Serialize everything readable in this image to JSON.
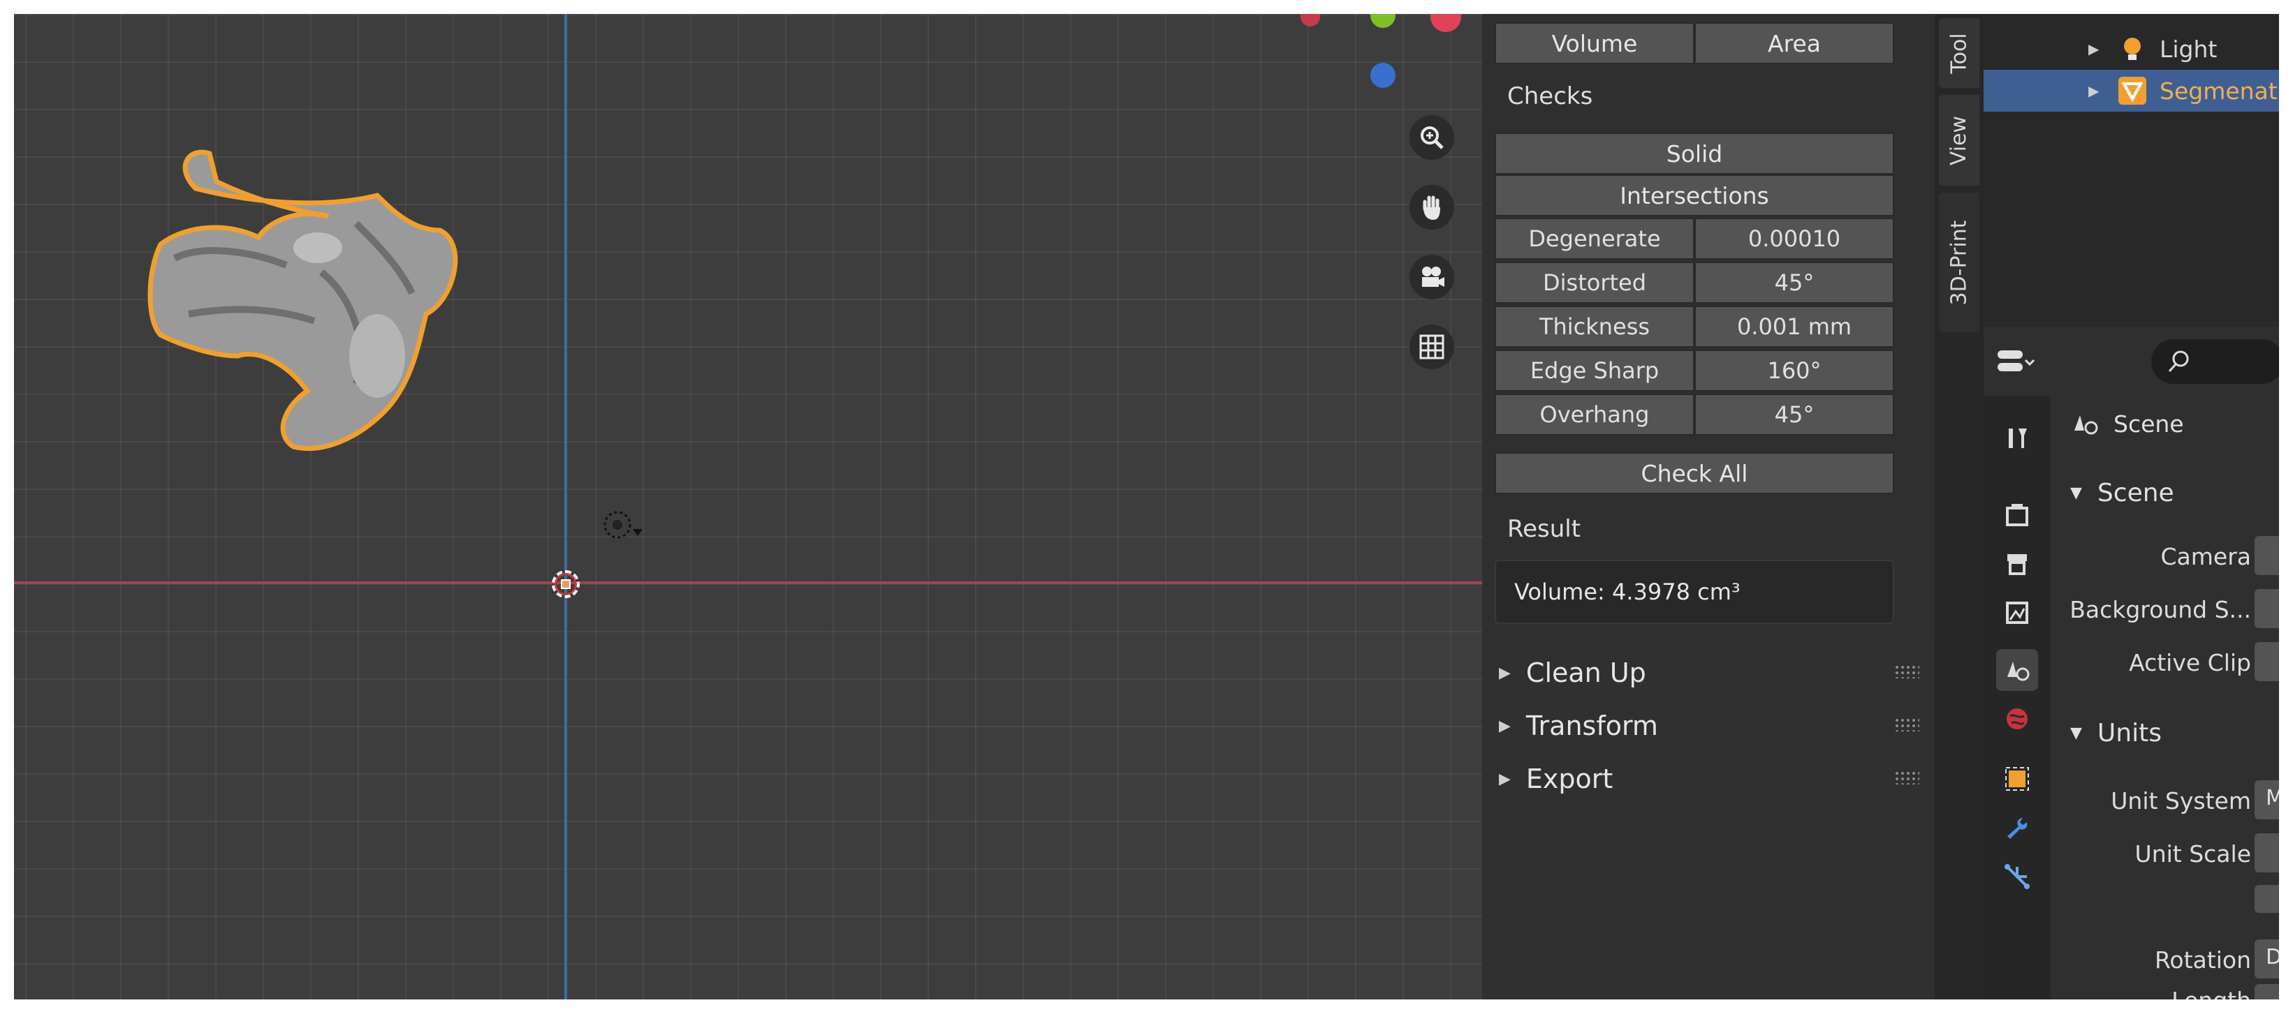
{
  "sidebar_panel": {
    "mode_buttons": [
      "Volume",
      "Area"
    ],
    "checks_label": "Checks",
    "check_buttons": [
      "Solid",
      "Intersections"
    ],
    "check_params": [
      {
        "label": "Degenerate",
        "value": "0.00010"
      },
      {
        "label": "Distorted",
        "value": "45°"
      },
      {
        "label": "Thickness",
        "value": "0.001 mm"
      },
      {
        "label": "Edge Sharp",
        "value": "160°"
      },
      {
        "label": "Overhang",
        "value": "45°"
      }
    ],
    "check_all_label": "Check All",
    "result_label": "Result",
    "result_value": "Volume: 4.3978 cm³",
    "sections": [
      "Clean Up",
      "Transform",
      "Export"
    ]
  },
  "tabs": [
    "Tool",
    "View",
    "3D-Print"
  ],
  "outliner": {
    "items": [
      {
        "label": "Light",
        "icon": "light-icon",
        "selected": false
      },
      {
        "label": "Segmenat",
        "icon": "mesh-icon",
        "selected": true
      }
    ]
  },
  "properties": {
    "breadcrumb": "Scene",
    "scene_section": "Scene",
    "scene_fields": [
      "Camera",
      "Background S...",
      "Active Clip"
    ],
    "units_section": "Units",
    "units_fields": [
      "Unit System",
      "Unit Scale",
      "Rotation",
      "Length"
    ],
    "field_value_stubs": [
      "M",
      "D"
    ]
  },
  "colors": {
    "accent_orange": "#f0a030",
    "selection_blue": "#3f5f93",
    "axis_x": "#a3444e",
    "axis_y": "#3a6ea3"
  },
  "icons": [
    "zoom-icon",
    "pan-hand-icon",
    "camera-view-icon",
    "grid-ortho-icon"
  ]
}
